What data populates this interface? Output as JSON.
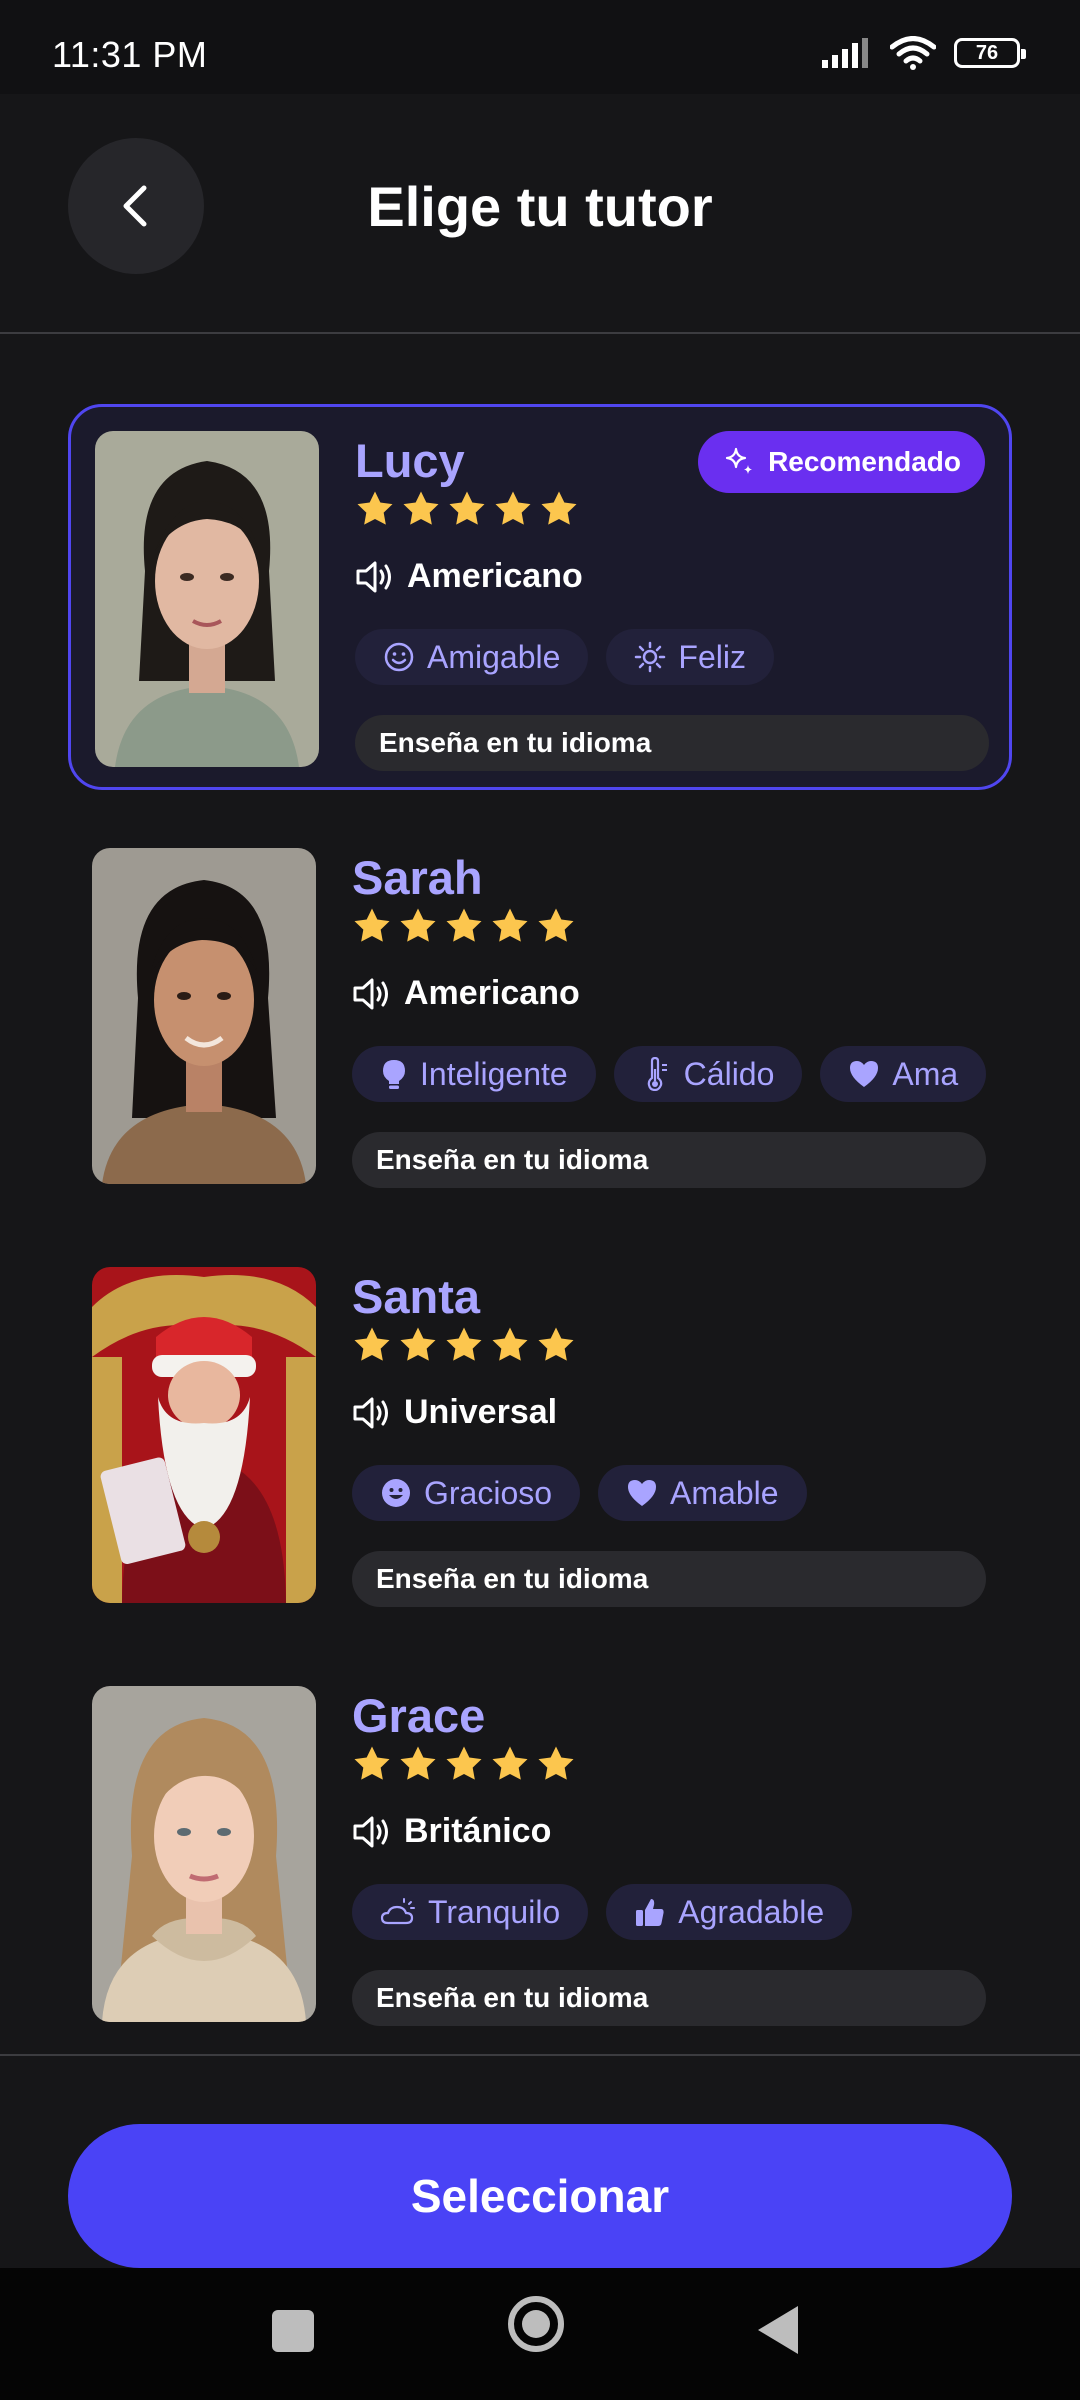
{
  "status_bar": {
    "time": "11:31 PM",
    "battery": "76"
  },
  "header": {
    "title": "Elige tu tutor"
  },
  "tutors": [
    {
      "name": "Lucy",
      "rating": 5,
      "accent": "Americano",
      "badge": "Recomendado",
      "tags": [
        {
          "label": "Amigable",
          "icon": "smile-icon"
        },
        {
          "label": "Feliz",
          "icon": "sun-icon"
        }
      ],
      "teaching": "Enseña en tu idioma",
      "selected": true
    },
    {
      "name": "Sarah",
      "rating": 5,
      "accent": "Americano",
      "tags": [
        {
          "label": "Inteligente",
          "icon": "lightbulb-icon"
        },
        {
          "label": "Cálido",
          "icon": "thermometer-icon"
        },
        {
          "label": "Ama",
          "icon": "heart-icon"
        }
      ],
      "teaching": "Enseña en tu idioma",
      "selected": false
    },
    {
      "name": "Santa",
      "rating": 5,
      "accent": "Universal",
      "tags": [
        {
          "label": "Gracioso",
          "icon": "laugh-icon"
        },
        {
          "label": "Amable",
          "icon": "heart-icon"
        }
      ],
      "teaching": "Enseña en tu idioma",
      "selected": false
    },
    {
      "name": "Grace",
      "rating": 5,
      "accent": "Británico",
      "tags": [
        {
          "label": "Tranquilo",
          "icon": "cloud-sun-icon"
        },
        {
          "label": "Agradable",
          "icon": "thumbs-up-icon"
        }
      ],
      "teaching": "Enseña en tu idioma",
      "selected": false
    }
  ],
  "footer": {
    "select_label": "Seleccionar"
  },
  "colors": {
    "accent": "#a9a4ff",
    "primary": "#4a43f6",
    "badge": "#6a2ff0",
    "star": "#fcc64e",
    "background": "#161618"
  }
}
